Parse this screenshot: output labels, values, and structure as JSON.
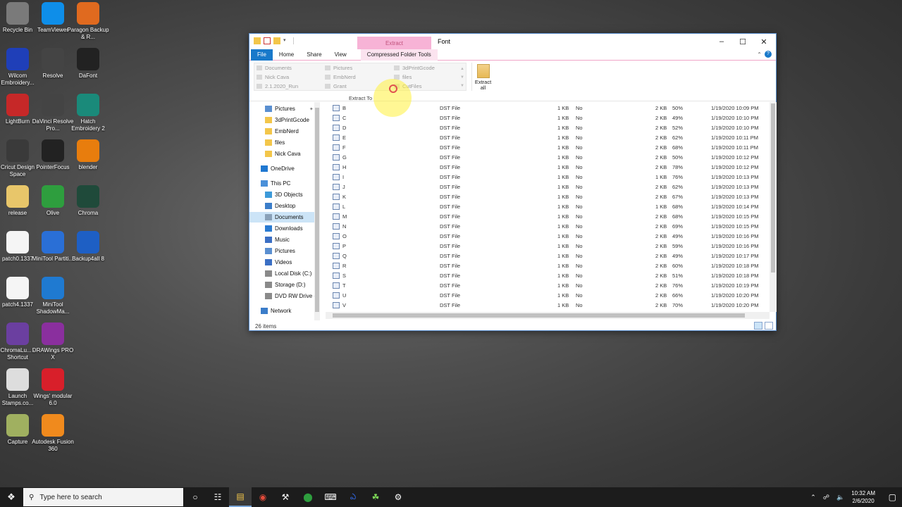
{
  "desktop": {
    "icons": [
      {
        "label": "Recycle Bin",
        "icon": "recycle-bin-icon",
        "color": "#7a7a7a"
      },
      {
        "label": "TeamViewer",
        "icon": "teamviewer-icon",
        "color": "#0e8ee9"
      },
      {
        "label": "Paragon Backup & R...",
        "icon": "paragon-icon",
        "color": "#e06a1f"
      },
      {
        "label": "Wilcom Embroidery...",
        "icon": "wilcom-icon",
        "color": "#1f3fb8"
      },
      {
        "label": "Resolve",
        "icon": "resolve-icon",
        "color": "#444444"
      },
      {
        "label": "DaFont",
        "icon": "dafont-icon",
        "color": "#222222"
      },
      {
        "label": "LightBurn",
        "icon": "lightburn-icon",
        "color": "#c62828"
      },
      {
        "label": "DaVinci Resolve Pro...",
        "icon": "davinci-icon",
        "color": "#444444"
      },
      {
        "label": "Hatch Embroidery 2",
        "icon": "hatch-icon",
        "color": "#1a8a7a"
      },
      {
        "label": "Cricut Design Space",
        "icon": "cricut-icon",
        "color": "#3a3a3a"
      },
      {
        "label": "PointerFocus",
        "icon": "pointerfocus-icon",
        "color": "#222222"
      },
      {
        "label": "blender",
        "icon": "blender-icon",
        "color": "#e87d0d"
      },
      {
        "label": "release",
        "icon": "release-icon",
        "color": "#e8c66a"
      },
      {
        "label": "Olive",
        "icon": "olive-icon",
        "color": "#2e9e3e"
      },
      {
        "label": "Chroma",
        "icon": "chroma-icon",
        "color": "#1f4a3a"
      },
      {
        "label": "patch0.1337",
        "icon": "file-icon",
        "color": "#f5f5f5"
      },
      {
        "label": "MiniTool Partiti...",
        "icon": "minitool-icon",
        "color": "#2a6fd6"
      },
      {
        "label": "Backup4all 8",
        "icon": "backup4all-icon",
        "color": "#1e5fc4"
      },
      {
        "label": "patch4.1337",
        "icon": "file-icon",
        "color": "#f5f5f5"
      },
      {
        "label": "MiniTool ShadowMa...",
        "icon": "shadowmaker-icon",
        "color": "#1f7ad1"
      },
      {
        "label": "ChromaLu... - Shortcut",
        "icon": "chromalux-icon",
        "color": "#6b3fa0"
      },
      {
        "label": "DRAWings PRO X",
        "icon": "drawings-icon",
        "color": "#8a2f9e"
      },
      {
        "label": "Launch Stamps.co...",
        "icon": "stamps-icon",
        "color": "#dddddd"
      },
      {
        "label": "Wings' modular 6.0",
        "icon": "wings-icon",
        "color": "#d81f2a"
      },
      {
        "label": "Capture",
        "icon": "capture-icon",
        "color": "#a0b060"
      },
      {
        "label": "Autodesk Fusion 360",
        "icon": "fusion-icon",
        "color": "#f08a1d"
      }
    ]
  },
  "window": {
    "title": "Font",
    "context_group": "Extract",
    "tabs": [
      "File",
      "Home",
      "Share",
      "View",
      "Compressed Folder Tools"
    ],
    "ribbon": {
      "gallery": [
        [
          "Documents",
          "Pictures",
          "3dPrintGcode"
        ],
        [
          "Nick Cava",
          "EmbNerd",
          "files"
        ],
        [
          "2.1.2020_Run",
          "Grant",
          "CutFiles"
        ]
      ],
      "group_label": "Extract To",
      "extract_all": "Extract all"
    },
    "nav": [
      {
        "label": "Pictures",
        "icon": "pictures-icon",
        "indent": 1,
        "pinned": true
      },
      {
        "label": "3dPrintGcode",
        "icon": "folder-icon",
        "indent": 1
      },
      {
        "label": "EmbNerd",
        "icon": "folder-icon",
        "indent": 1
      },
      {
        "label": "files",
        "icon": "folder-icon",
        "indent": 1
      },
      {
        "label": "Nick Cava",
        "icon": "folder-icon",
        "indent": 1
      },
      {
        "label": "OneDrive",
        "icon": "onedrive-icon",
        "indent": 0
      },
      {
        "label": "This PC",
        "icon": "this-pc-icon",
        "indent": 0
      },
      {
        "label": "3D Objects",
        "icon": "3d-objects-icon",
        "indent": 1
      },
      {
        "label": "Desktop",
        "icon": "desktop-icon",
        "indent": 1
      },
      {
        "label": "Documents",
        "icon": "documents-icon",
        "indent": 1,
        "selected": true
      },
      {
        "label": "Downloads",
        "icon": "downloads-icon",
        "indent": 1
      },
      {
        "label": "Music",
        "icon": "music-icon",
        "indent": 1
      },
      {
        "label": "Pictures",
        "icon": "pictures-icon",
        "indent": 1
      },
      {
        "label": "Videos",
        "icon": "videos-icon",
        "indent": 1
      },
      {
        "label": "Local Disk (C:)",
        "icon": "disk-icon",
        "indent": 1
      },
      {
        "label": "Storage (D:)",
        "icon": "disk-icon",
        "indent": 1
      },
      {
        "label": "DVD RW Drive (E",
        "icon": "dvd-icon",
        "indent": 1
      },
      {
        "label": "Network",
        "icon": "network-icon",
        "indent": 0
      }
    ],
    "files": [
      {
        "name": "B",
        "type": "DST File",
        "packed": "1 KB",
        "protected": "No",
        "size": "2 KB",
        "ratio": "50%",
        "date": "1/19/2020 10:09 PM"
      },
      {
        "name": "C",
        "type": "DST File",
        "packed": "1 KB",
        "protected": "No",
        "size": "2 KB",
        "ratio": "49%",
        "date": "1/19/2020 10:10 PM"
      },
      {
        "name": "D",
        "type": "DST File",
        "packed": "1 KB",
        "protected": "No",
        "size": "2 KB",
        "ratio": "52%",
        "date": "1/19/2020 10:10 PM"
      },
      {
        "name": "E",
        "type": "DST File",
        "packed": "1 KB",
        "protected": "No",
        "size": "2 KB",
        "ratio": "62%",
        "date": "1/19/2020 10:11 PM"
      },
      {
        "name": "F",
        "type": "DST File",
        "packed": "1 KB",
        "protected": "No",
        "size": "2 KB",
        "ratio": "68%",
        "date": "1/19/2020 10:11 PM"
      },
      {
        "name": "G",
        "type": "DST File",
        "packed": "1 KB",
        "protected": "No",
        "size": "2 KB",
        "ratio": "50%",
        "date": "1/19/2020 10:12 PM"
      },
      {
        "name": "H",
        "type": "DST File",
        "packed": "1 KB",
        "protected": "No",
        "size": "2 KB",
        "ratio": "78%",
        "date": "1/19/2020 10:12 PM"
      },
      {
        "name": "I",
        "type": "DST File",
        "packed": "1 KB",
        "protected": "No",
        "size": "1 KB",
        "ratio": "76%",
        "date": "1/19/2020 10:13 PM"
      },
      {
        "name": "J",
        "type": "DST File",
        "packed": "1 KB",
        "protected": "No",
        "size": "2 KB",
        "ratio": "62%",
        "date": "1/19/2020 10:13 PM"
      },
      {
        "name": "K",
        "type": "DST File",
        "packed": "1 KB",
        "protected": "No",
        "size": "2 KB",
        "ratio": "67%",
        "date": "1/19/2020 10:13 PM"
      },
      {
        "name": "L",
        "type": "DST File",
        "packed": "1 KB",
        "protected": "No",
        "size": "1 KB",
        "ratio": "68%",
        "date": "1/19/2020 10:14 PM"
      },
      {
        "name": "M",
        "type": "DST File",
        "packed": "1 KB",
        "protected": "No",
        "size": "2 KB",
        "ratio": "68%",
        "date": "1/19/2020 10:15 PM"
      },
      {
        "name": "N",
        "type": "DST File",
        "packed": "1 KB",
        "protected": "No",
        "size": "2 KB",
        "ratio": "69%",
        "date": "1/19/2020 10:15 PM"
      },
      {
        "name": "O",
        "type": "DST File",
        "packed": "1 KB",
        "protected": "No",
        "size": "2 KB",
        "ratio": "49%",
        "date": "1/19/2020 10:16 PM"
      },
      {
        "name": "P",
        "type": "DST File",
        "packed": "1 KB",
        "protected": "No",
        "size": "2 KB",
        "ratio": "59%",
        "date": "1/19/2020 10:16 PM"
      },
      {
        "name": "Q",
        "type": "DST File",
        "packed": "1 KB",
        "protected": "No",
        "size": "2 KB",
        "ratio": "49%",
        "date": "1/19/2020 10:17 PM"
      },
      {
        "name": "R",
        "type": "DST File",
        "packed": "1 KB",
        "protected": "No",
        "size": "2 KB",
        "ratio": "60%",
        "date": "1/19/2020 10:18 PM"
      },
      {
        "name": "S",
        "type": "DST File",
        "packed": "1 KB",
        "protected": "No",
        "size": "2 KB",
        "ratio": "51%",
        "date": "1/19/2020 10:18 PM"
      },
      {
        "name": "T",
        "type": "DST File",
        "packed": "1 KB",
        "protected": "No",
        "size": "2 KB",
        "ratio": "76%",
        "date": "1/19/2020 10:19 PM"
      },
      {
        "name": "U",
        "type": "DST File",
        "packed": "1 KB",
        "protected": "No",
        "size": "2 KB",
        "ratio": "66%",
        "date": "1/19/2020 10:20 PM"
      },
      {
        "name": "V",
        "type": "DST File",
        "packed": "1 KB",
        "protected": "No",
        "size": "2 KB",
        "ratio": "70%",
        "date": "1/19/2020 10:20 PM"
      }
    ],
    "status": "26 items",
    "accent": "#1979ca",
    "context_color": "#f7b3d6"
  },
  "taskbar": {
    "search_placeholder": "Type here to search",
    "apps": [
      "cortana-icon",
      "task-view-icon",
      "file-explorer-icon",
      "chrome-icon",
      "app-icon",
      "xbox-icon",
      "calculator-icon",
      "wilcom-icon",
      "cricut-icon",
      "settings-icon"
    ],
    "time": "10:32 AM",
    "date": "2/6/2020"
  }
}
